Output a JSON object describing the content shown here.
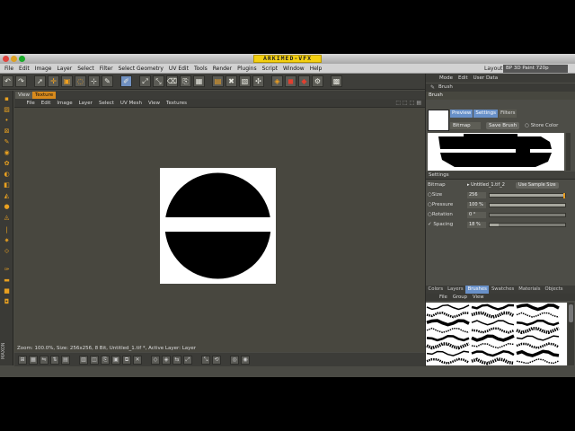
{
  "titlebar": {
    "logo_text": "ARKIMED-VFX"
  },
  "menubar": {
    "items": [
      "File",
      "Edit",
      "Image",
      "Layer",
      "Select",
      "Filter",
      "Select Geometry",
      "UV Edit",
      "Tools",
      "Render",
      "Plugins",
      "Script",
      "Window",
      "Help"
    ],
    "layout_label": "Layout:",
    "layout_value": "BP 3D Paint 720p"
  },
  "view": {
    "tabs": [
      "View",
      "Texture"
    ],
    "active_tab": "Texture",
    "menu": [
      "File",
      "Edit",
      "Image",
      "Layer",
      "Select",
      "UV Mesh",
      "View",
      "Textures"
    ],
    "status": "Zoom: 100.0%, Size: 256x256, 8 Bit, Untitled_1.tif *, Active Layer: Layer"
  },
  "attributes": {
    "mode_menu": [
      "Mode",
      "Edit",
      "User Data"
    ],
    "header": "Brush",
    "subheader": "Brush",
    "tabs": [
      "Preview",
      "Settings",
      "Filters"
    ],
    "bitmap_select": "Bitmap",
    "save_brush": "Save Brush",
    "store_color": "Store Color",
    "settings_title": "Settings",
    "params": {
      "bitmap": {
        "label": "Bitmap",
        "value": "Untitled_1.tif_2",
        "button": "Use Sample Size"
      },
      "size": {
        "label": "Size",
        "value": "256",
        "fraction": 1.0
      },
      "pressure": {
        "label": "Pressure",
        "value": "100 %",
        "fraction": 1.0
      },
      "rotation": {
        "label": "Rotation",
        "value": "0 °",
        "fraction": 0.0
      },
      "spacing": {
        "label": "Spacing",
        "value": "18 %",
        "fraction": 0.12
      }
    }
  },
  "browser": {
    "tabs": [
      "Colors",
      "Layers",
      "Brushes",
      "Swatches",
      "Materials",
      "Objects"
    ],
    "active_tab": "Brushes",
    "menu": [
      "File",
      "Group",
      "View"
    ]
  },
  "colors": {
    "accent_orange": "#d88a1c",
    "selection_blue": "#6890c8",
    "logo_yellow": "#f4d010"
  }
}
